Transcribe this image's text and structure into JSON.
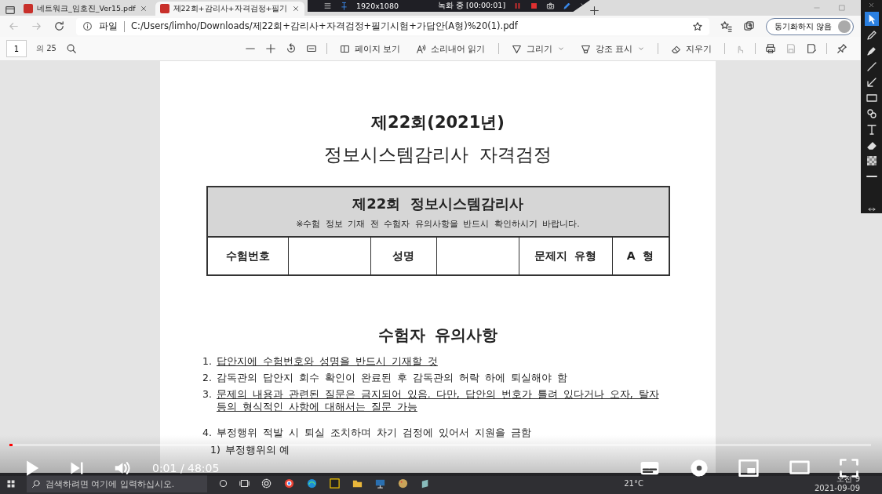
{
  "browser": {
    "tabs": [
      {
        "title": "네트워크_임호진_Ver15.pdf",
        "selected": false
      },
      {
        "title": "제22회+감리사+자격검정+필기",
        "selected": true
      }
    ]
  },
  "recorder": {
    "resolution": "1920x1080",
    "status": "녹화 중 [00:00:01]"
  },
  "address_bar": {
    "scheme_label": "파일",
    "url": "C:/Users/limho/Downloads/제22회+감리사+자격검정+필기시험+가답안(A형)%20(1).pdf",
    "profile_button": "동기화하지 않음"
  },
  "pdf_toolbar": {
    "page": "1",
    "page_count": "의 25",
    "buttons": [
      {
        "label": "페이지 보기",
        "dropdown": false
      },
      {
        "label": "소리내어 읽기",
        "dropdown": false
      },
      {
        "label": "그리기",
        "dropdown": true
      },
      {
        "label": "강조 표시",
        "dropdown": true
      },
      {
        "label": "지우기",
        "dropdown": false
      }
    ]
  },
  "document": {
    "title": "제22회(2021년)",
    "subtitle": "정보시스템감리사 자격검정",
    "form": {
      "heading": "제22회 정보시스템감리사",
      "note": "※수험 정보 기재 전 수험자 유의사항을 반드시 확인하시기 바랍니다.",
      "fields": [
        {
          "label": "수험번호"
        },
        {
          "label": "성명"
        },
        {
          "label": "문제지 유형",
          "value": "A 형"
        }
      ]
    },
    "notice_title": "수험자 유의사항",
    "notices": [
      {
        "number": "1.",
        "text": "답안지에 수험번호와 성명을 반드시 기재할 것",
        "underlined": true
      },
      {
        "number": "2.",
        "text": "감독관의 답안지 회수 확인이 완료된 후 감독관의 허락 하에 퇴실해야 함",
        "underlined": false
      },
      {
        "number": "3.",
        "text": "문제의 내용과 관련된 질문은 금지되어 있음. 다만, 답안의 번호가 틀려 있다거나 오자, 탈자 등의 형식적인 사항에 대해서는 질문 가능",
        "underlined": true
      },
      {
        "number": "4.",
        "text": "부정행위 적발 시 퇴실 조치하며 차기 검정에 있어서 지원을 금함",
        "underlined": false,
        "children": [
          {
            "number": "1)",
            "text": "부정행위의 예"
          }
        ]
      }
    ]
  },
  "taskbar": {
    "search_placeholder": "검색하려면 여기에 입력하십시오.",
    "weather": "21°C",
    "time": "오전 9",
    "date": "2021-09-09"
  },
  "player": {
    "progress": {
      "level": 0.004
    },
    "time": "0:01 / 48:05"
  }
}
